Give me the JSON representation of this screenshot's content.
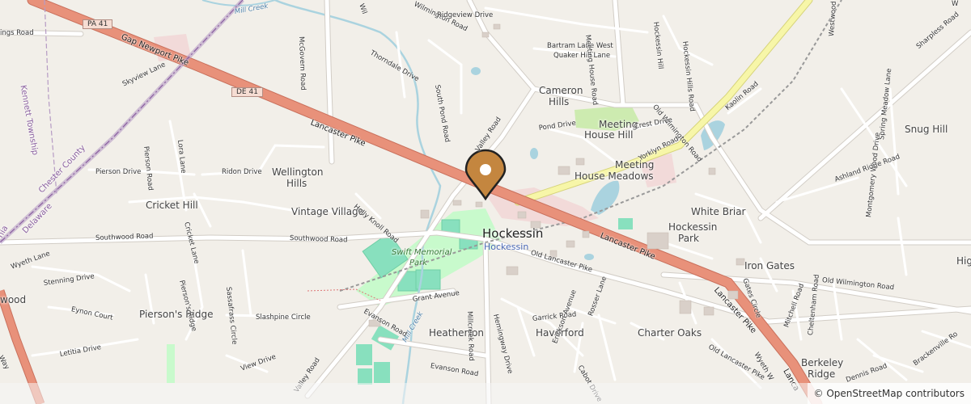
{
  "map": {
    "colors": {
      "background": "#f2efe9",
      "motorway": "#e8917a",
      "yellow_road": "#f7f6a8",
      "water": "#aad3df",
      "park": "#c8facc",
      "pitch": "#88e0be",
      "marker": "#c4863f"
    },
    "marker": {
      "name": "location-pin-icon"
    },
    "places": [
      {
        "key": "hockessin",
        "text": "Hockessin"
      },
      {
        "key": "hockessin_sub",
        "text": "Hockessin"
      },
      {
        "key": "wellington",
        "text": "Wellington"
      },
      {
        "key": "hills",
        "text": "Hills"
      },
      {
        "key": "cricket_hill",
        "text": "Cricket Hill"
      },
      {
        "key": "vintage_village",
        "text": "Vintage Village"
      },
      {
        "key": "cameron",
        "text": "Cameron"
      },
      {
        "key": "cameron_hills",
        "text": "Hills"
      },
      {
        "key": "mh_hill_1",
        "text": "Meeting"
      },
      {
        "key": "mh_hill_2",
        "text": "House Hill"
      },
      {
        "key": "mh_meadows_1",
        "text": "Meeting"
      },
      {
        "key": "mh_meadows_2",
        "text": "House Meadows"
      },
      {
        "key": "snug_hill",
        "text": "Snug Hill"
      },
      {
        "key": "white_briar",
        "text": "White Briar"
      },
      {
        "key": "hockessin_park_1",
        "text": "Hockessin"
      },
      {
        "key": "hockessin_park_2",
        "text": "Park"
      },
      {
        "key": "iron_gates",
        "text": "Iron Gates"
      },
      {
        "key": "swift_memorial_1",
        "text": "Swift Memorial"
      },
      {
        "key": "swift_memorial_2",
        "text": "Park"
      },
      {
        "key": "piersons_ridge",
        "text": "Pierson's Ridge"
      },
      {
        "key": "heatherton",
        "text": "Heatherton"
      },
      {
        "key": "haverford",
        "text": "Haverford"
      },
      {
        "key": "charter_oaks",
        "text": "Charter Oaks"
      },
      {
        "key": "berkeley_1",
        "text": "Berkeley"
      },
      {
        "key": "berkeley_2",
        "text": "Ridge"
      },
      {
        "key": "wood",
        "text": "wood"
      },
      {
        "key": "high",
        "text": "High"
      },
      {
        "key": "kennett",
        "text": "Kennett Township"
      },
      {
        "key": "chester",
        "text": "Chester County"
      },
      {
        "key": "delaware",
        "text": "Delaware"
      },
      {
        "key": "nia",
        "text": "nia"
      }
    ],
    "roads": [
      {
        "key": "gap_newport",
        "text": "Gap Newport Pike"
      },
      {
        "key": "lancaster_1",
        "text": "Lancaster Pike"
      },
      {
        "key": "lancaster_2",
        "text": "Lancaster Pike"
      },
      {
        "key": "lancaster_3",
        "text": "Lancaster Pike"
      },
      {
        "key": "lancaster_4",
        "text": "Lanca"
      },
      {
        "key": "southwood_1",
        "text": "Southwood Road"
      },
      {
        "key": "southwood_2",
        "text": "Southwood Road"
      },
      {
        "key": "old_lancaster_1",
        "text": "Old Lancaster Pike"
      },
      {
        "key": "old_lancaster_2",
        "text": "Old Lancaster Pike"
      },
      {
        "key": "old_wilmington_1",
        "text": "Old Wilmington Road"
      },
      {
        "key": "old_wilmington_2",
        "text": "Old Wilmington Road"
      },
      {
        "key": "yorklyn",
        "text": "Yorklyn Road"
      },
      {
        "key": "valley_1",
        "text": "Valley Road"
      },
      {
        "key": "valley_2",
        "text": "Valley Road"
      },
      {
        "key": "millcreek_road",
        "text": "Millcreek Road"
      },
      {
        "key": "mill_creek_1",
        "text": "Mill Creek"
      },
      {
        "key": "mill_creek_2",
        "text": "Mill Creek"
      },
      {
        "key": "mcgovern",
        "text": "McGovern Road"
      },
      {
        "key": "thorndale",
        "text": "Thorndale Drive"
      },
      {
        "key": "wilmington",
        "text": "Wilmington Road"
      },
      {
        "key": "ridgeview",
        "text": "Ridgeview Drive"
      },
      {
        "key": "bartram",
        "text": "Bartram Lane West"
      },
      {
        "key": "quaker",
        "text": "Quaker Hill Lane"
      },
      {
        "key": "meeting_house_road",
        "text": "Meeting House Road"
      },
      {
        "key": "hockessin_hills_1",
        "text": "Hockessin Hill"
      },
      {
        "key": "hockessin_hills_2",
        "text": "Hockessin Hills Road"
      },
      {
        "key": "south_pond",
        "text": "South Pond Road"
      },
      {
        "key": "pond_drive",
        "text": "Pond Drive"
      },
      {
        "key": "crest",
        "text": "Crest Drive"
      },
      {
        "key": "kaolin",
        "text": "Kaolin Road"
      },
      {
        "key": "ashland",
        "text": "Ashland Ridge Road"
      },
      {
        "key": "sharpless",
        "text": "Sharpless Road"
      },
      {
        "key": "westwood",
        "text": "Westwood Rd"
      },
      {
        "key": "spring_meadow",
        "text": "Spring Meadow Lane"
      },
      {
        "key": "montgomery",
        "text": "Montgomery Wood Drive"
      },
      {
        "key": "gates_circle",
        "text": "Gates Circle"
      },
      {
        "key": "mitchell",
        "text": "Mitchell Road"
      },
      {
        "key": "cheltenham",
        "text": "Cheltenham Road"
      },
      {
        "key": "brackenville",
        "text": "Brackenville Ro"
      },
      {
        "key": "dennis",
        "text": "Dennis Road"
      },
      {
        "key": "wyeth_1",
        "text": "Wyeth Lane"
      },
      {
        "key": "wyeth_2",
        "text": "Wyeth W"
      },
      {
        "key": "skyview",
        "text": "Skyview Lane"
      },
      {
        "key": "gs_road",
        "text": "ings Road"
      },
      {
        "key": "pierson_drive",
        "text": "Pierson Drive"
      },
      {
        "key": "pierson_road",
        "text": "Pierson Road"
      },
      {
        "key": "lora",
        "text": "Lora Lane"
      },
      {
        "key": "ridon",
        "text": "Ridon Drive"
      },
      {
        "key": "holly_knoll",
        "text": "Holly Knoll Road"
      },
      {
        "key": "cricket_lane",
        "text": "Cricket Lane"
      },
      {
        "key": "piersons_ridge_road",
        "text": "Pierson's Ridge"
      },
      {
        "key": "sassafrass",
        "text": "Sassafrass Circle"
      },
      {
        "key": "slashpine",
        "text": "Slashpine Circle"
      },
      {
        "key": "stenning",
        "text": "Stenning Drive"
      },
      {
        "key": "eynon",
        "text": "Eynon Court"
      },
      {
        "key": "letitia",
        "text": "Letitia Drive"
      },
      {
        "key": "view_drive",
        "text": "View Drive"
      },
      {
        "key": "grant",
        "text": "Grant Avenue"
      },
      {
        "key": "evanson_1",
        "text": "Evanson Road"
      },
      {
        "key": "evanson_2",
        "text": "Evanson Road"
      },
      {
        "key": "hemingway",
        "text": "Hemingway Drive"
      },
      {
        "key": "garrick",
        "text": "Garrick Road"
      },
      {
        "key": "erickson",
        "text": "Erickson Avenue"
      },
      {
        "key": "rosser",
        "text": "Rosser Lane"
      },
      {
        "key": "cabot",
        "text": "Cabot Drive"
      },
      {
        "key": "way",
        "text": "Way"
      },
      {
        "key": "wil",
        "text": "Wil"
      },
      {
        "key": "w",
        "text": "W"
      }
    ],
    "shields": [
      {
        "key": "pa41",
        "text": "PA 41"
      },
      {
        "key": "de41",
        "text": "DE 41"
      }
    ],
    "attribution": "© OpenStreetMap contributors"
  }
}
